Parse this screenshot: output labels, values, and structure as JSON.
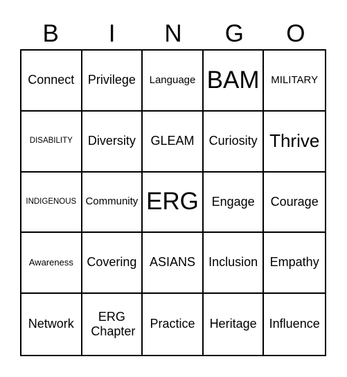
{
  "header": {
    "letters": [
      "B",
      "I",
      "N",
      "G",
      "O"
    ]
  },
  "cells": [
    [
      {
        "text": "Connect",
        "size": "lg"
      },
      {
        "text": "Privilege",
        "size": "lg"
      },
      {
        "text": "Language",
        "size": "md"
      },
      {
        "text": "BAM",
        "size": "xxl"
      },
      {
        "text": "MILITARY",
        "size": "md"
      }
    ],
    [
      {
        "text": "DISABILITY",
        "size": "xs"
      },
      {
        "text": "Diversity",
        "size": "lg"
      },
      {
        "text": "GLEAM",
        "size": "lg"
      },
      {
        "text": "Curiosity",
        "size": "lg"
      },
      {
        "text": "Thrive",
        "size": "xl"
      }
    ],
    [
      {
        "text": "INDIGENOUS",
        "size": "xs"
      },
      {
        "text": "Community",
        "size": "md"
      },
      {
        "text": "ERG",
        "size": "xxl"
      },
      {
        "text": "Engage",
        "size": "lg"
      },
      {
        "text": "Courage",
        "size": "lg"
      }
    ],
    [
      {
        "text": "Awareness",
        "size": "sm"
      },
      {
        "text": "Covering",
        "size": "lg"
      },
      {
        "text": "ASIANS",
        "size": "lg"
      },
      {
        "text": "Inclusion",
        "size": "lg"
      },
      {
        "text": "Empathy",
        "size": "lg"
      }
    ],
    [
      {
        "text": "Network",
        "size": "lg"
      },
      {
        "text": "ERG Chapter",
        "size": "lg"
      },
      {
        "text": "Practice",
        "size": "lg"
      },
      {
        "text": "Heritage",
        "size": "lg"
      },
      {
        "text": "Influence",
        "size": "lg"
      }
    ]
  ]
}
